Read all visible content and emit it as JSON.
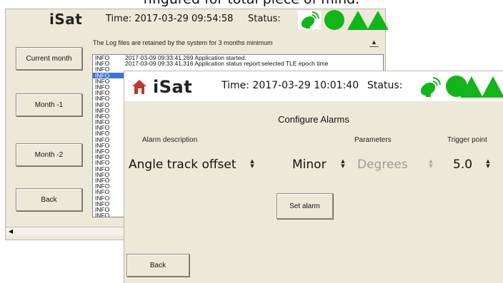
{
  "caption": "nfigured for total piece of mind.",
  "back_window": {
    "logo": "iSat",
    "time": "Time: 2017-03-29 09:54:58",
    "status_label": "Status:",
    "buttons": {
      "current_month": "Current month",
      "month_1": "Month -1",
      "month_2": "Month -2",
      "back": "Back"
    },
    "retention_notice": "The Log files are retained by the system for 3 months minimum",
    "log_rows": [
      {
        "level": "INFO",
        "message": "2017-03-09 09:33:41,269 Application started."
      },
      {
        "level": "INFO",
        "message": "2017-03-09 09:33:41,316 Application status report:selected TLE epoch time"
      },
      {
        "level": "INFO",
        "message": ""
      },
      {
        "level": "INFO",
        "message": "",
        "selected": true
      },
      {
        "level": "INFO",
        "message": ""
      },
      {
        "level": "INFO",
        "message": ""
      },
      {
        "level": "INFO",
        "message": ""
      },
      {
        "level": "INFO",
        "message": ""
      },
      {
        "level": "INFO",
        "message": ""
      },
      {
        "level": "INFO",
        "message": ""
      },
      {
        "level": "INFO",
        "message": ""
      },
      {
        "level": "INFO",
        "message": ""
      },
      {
        "level": "INFO",
        "message": ""
      },
      {
        "level": "INFO",
        "message": ""
      },
      {
        "level": "INFO",
        "message": ""
      },
      {
        "level": "INFO",
        "message": ""
      },
      {
        "level": "INFO",
        "message": ""
      },
      {
        "level": "INFO",
        "message": ""
      },
      {
        "level": "INFO",
        "message": ""
      },
      {
        "level": "INFO",
        "message": ""
      },
      {
        "level": "INFO",
        "message": ""
      },
      {
        "level": "INFO",
        "message": ""
      },
      {
        "level": "INFO",
        "message": ""
      },
      {
        "level": "INFO",
        "message": ""
      },
      {
        "level": "INFO",
        "message": ""
      },
      {
        "level": "INFO",
        "message": ""
      },
      {
        "level": "INFO",
        "message": ""
      },
      {
        "level": "INFO",
        "message": ""
      }
    ]
  },
  "front_window": {
    "logo": "iSat",
    "time": "Time: 2017-03-29 10:01:40",
    "status_label": "Status:",
    "title": "Configure Alarms",
    "columns": {
      "alarm_description": "Alarm description",
      "parameters": "Parameters",
      "trigger_point": "Trigger point"
    },
    "alarm_description_value": "Angle track offset",
    "severity_value": "Minor",
    "parameters_value": "Degrees",
    "trigger_value": "5.0",
    "set_alarm_label": "Set alarm",
    "back_label": "Back"
  },
  "icons": {
    "satellite": "satellite-dish-icon",
    "status_ok": "green-circle-icon",
    "alerts": "green-triangle-icon",
    "home": "home-icon"
  },
  "colors": {
    "status_green": "#12b51a",
    "selection_blue": "#3875d7",
    "home_red": "#c0392b"
  }
}
